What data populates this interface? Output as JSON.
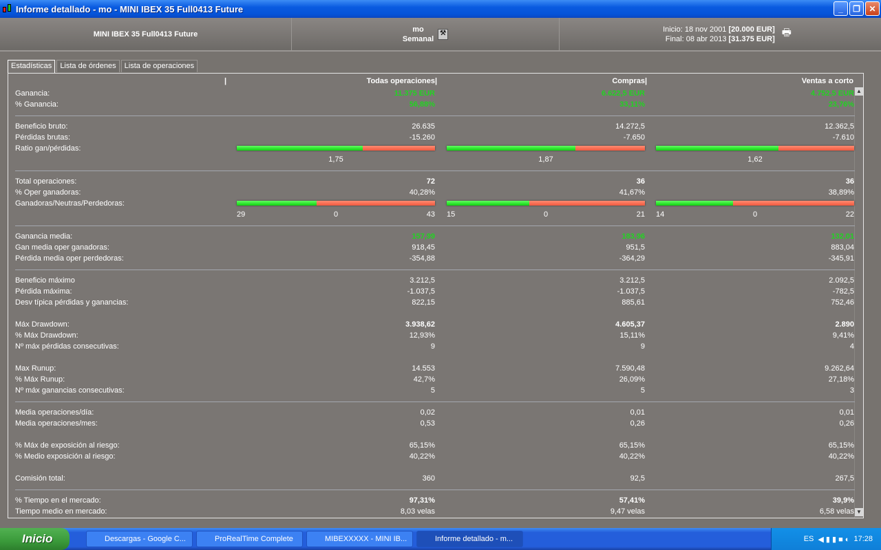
{
  "window": {
    "title": "Informe detallado - mo - MINI IBEX 35 Full0413 Future"
  },
  "header": {
    "instrument": "MINI IBEX 35 Full0413 Future",
    "system": "mo",
    "period": "Semanal",
    "start_label": "Inicio:",
    "start_date": "18 nov 2001",
    "start_capital": "[20.000 EUR]",
    "end_label": "Final:",
    "end_date": "08 abr 2013",
    "end_capital": "[31.375 EUR]"
  },
  "tabs": [
    "Estadísticas",
    "Lista de órdenes",
    "Lista de operaciones"
  ],
  "columns": [
    "Todas operaciones",
    "Compras",
    "Ventas a corto"
  ],
  "rows": [
    {
      "label": "Ganancia:",
      "values": [
        "11.375 EUR",
        "6.622,5 EUR",
        "4.752,5 EUR"
      ],
      "style": "green"
    },
    {
      "label": "% Ganancia:",
      "values": [
        "56,88%",
        "33,11%",
        "23,76%"
      ],
      "style": "green",
      "sep": true
    },
    {
      "label": "Beneficio bruto:",
      "values": [
        "26.635",
        "14.272,5",
        "12.362,5"
      ]
    },
    {
      "label": "Pérdidas brutas:",
      "values": [
        "-15.260",
        "-7.650",
        "-7.610"
      ]
    },
    {
      "label": "Ratio gan/pérdidas:",
      "bar": {
        "green_fraction": [
          0.636,
          0.651,
          0.619
        ],
        "center": [
          "1,75",
          "1,87",
          "1,62"
        ]
      },
      "sep": true
    },
    {
      "label": "Total operaciones:",
      "values": [
        "72",
        "36",
        "36"
      ],
      "style": "bold"
    },
    {
      "label": "% Oper ganadoras:",
      "values": [
        "40,28%",
        "41,67%",
        "38,89%"
      ]
    },
    {
      "label": "Ganadoras/Neutras/Perdedoras:",
      "bar": {
        "green_fraction": [
          0.403,
          0.417,
          0.389
        ],
        "counts": [
          [
            "29",
            "0",
            "43"
          ],
          [
            "15",
            "0",
            "21"
          ],
          [
            "14",
            "0",
            "22"
          ]
        ]
      },
      "sep": true
    },
    {
      "label": "Ganancia media:",
      "values": [
        "157,99",
        "183,96",
        "132,01"
      ],
      "style": "green"
    },
    {
      "label": "Gan media oper ganadoras:",
      "values": [
        "918,45",
        "951,5",
        "883,04"
      ]
    },
    {
      "label": "Pérdida media oper perdedoras:",
      "values": [
        "-354,88",
        "-364,29",
        "-345,91"
      ],
      "sep": true
    },
    {
      "label": "Beneficio máximo",
      "values": [
        "3.212,5",
        "3.212,5",
        "2.092,5"
      ]
    },
    {
      "label": "Pérdida máxima:",
      "values": [
        "-1.037,5",
        "-1.037,5",
        "-782,5"
      ]
    },
    {
      "label": "Desv típica pérdidas y ganancias:",
      "values": [
        "822,15",
        "885,61",
        "752,46"
      ],
      "gap": true
    },
    {
      "label": "Máx Drawdown:",
      "values": [
        "3.938,62",
        "4.605,37",
        "2.890"
      ],
      "style": "bold"
    },
    {
      "label": "% Máx Drawdown:",
      "values": [
        "12,93%",
        "15,11%",
        "9,41%"
      ]
    },
    {
      "label": "Nº máx pérdidas consecutivas:",
      "values": [
        "9",
        "9",
        "4"
      ],
      "gap": true
    },
    {
      "label": "Max Runup:",
      "values": [
        "14.553",
        "7.590,48",
        "9.262,64"
      ]
    },
    {
      "label": "% Máx Runup:",
      "values": [
        "42,7%",
        "26,09%",
        "27,18%"
      ]
    },
    {
      "label": "Nº máx ganancias consecutivas:",
      "values": [
        "5",
        "5",
        "3"
      ],
      "sep": true
    },
    {
      "label": "Media operaciones/día:",
      "values": [
        "0,02",
        "0,01",
        "0,01"
      ]
    },
    {
      "label": "Media operaciones/mes:",
      "values": [
        "0,53",
        "0,26",
        "0,26"
      ],
      "gap": true
    },
    {
      "label": "% Máx de exposición al riesgo:",
      "values": [
        "65,15%",
        "65,15%",
        "65,15%"
      ]
    },
    {
      "label": "% Medio exposición al riesgo:",
      "values": [
        "40,22%",
        "40,22%",
        "40,22%"
      ],
      "gap": true
    },
    {
      "label": "Comisión total:",
      "values": [
        "360",
        "92,5",
        "267,5"
      ],
      "sep": true
    },
    {
      "label": "% Tiempo en el mercado:",
      "values": [
        "97,31%",
        "57,41%",
        "39,9%"
      ],
      "style": "bold"
    },
    {
      "label": "Tiempo medio en mercado:",
      "values": [
        "8,03 velas",
        "9,47 velas",
        "6,58 velas"
      ]
    }
  ],
  "taskbar": {
    "start": "Inicio",
    "tasks": [
      "Descargas - Google C...",
      "ProRealTime Complete",
      "MIBEXXXXX - MINI IB...",
      "Informe detallado - m..."
    ],
    "lang": "ES",
    "clock": "17:28"
  }
}
